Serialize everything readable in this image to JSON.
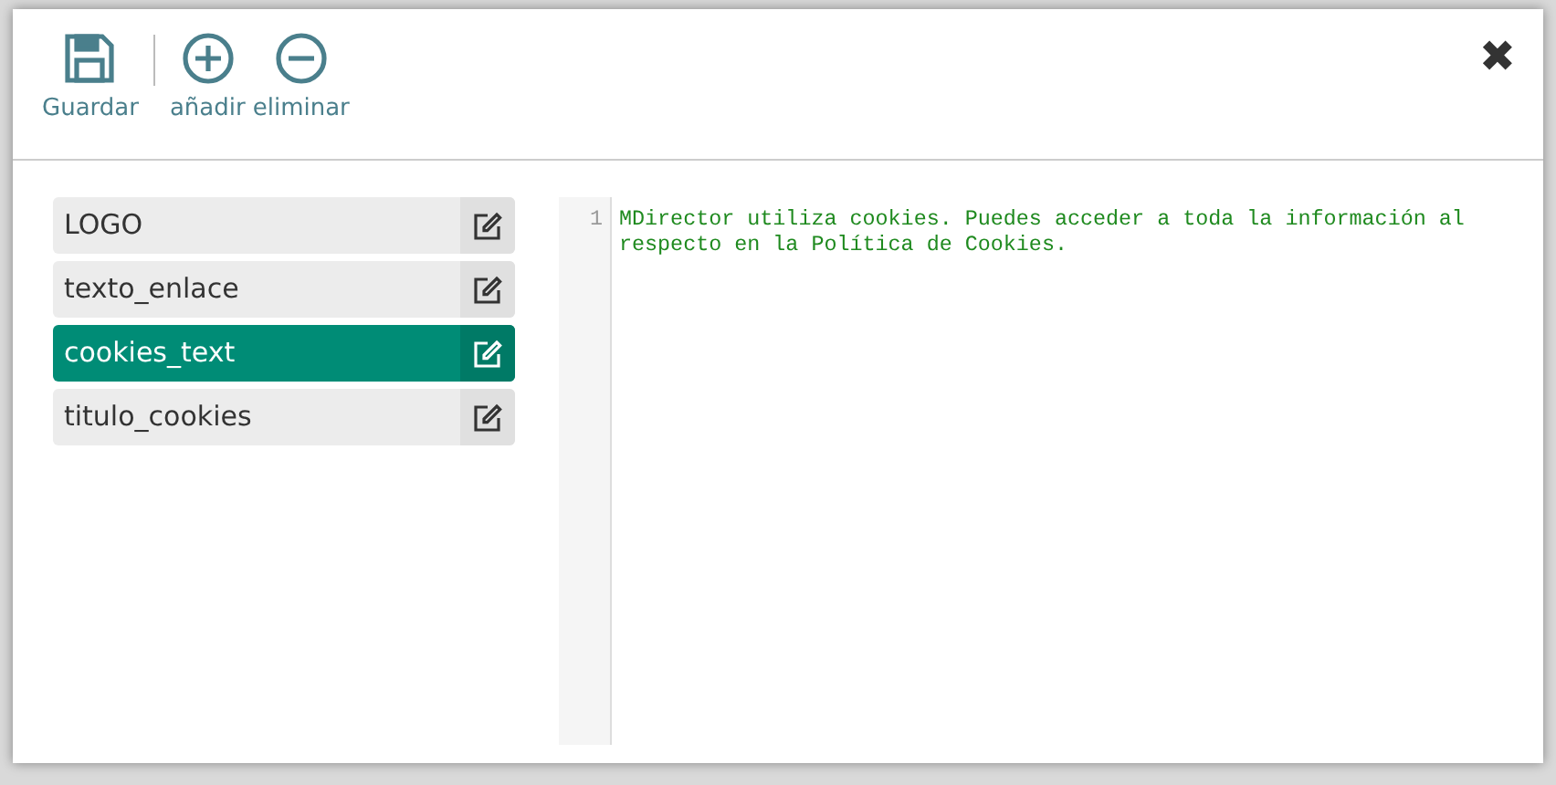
{
  "toolbar": [
    {
      "kind": "save",
      "label": "Guardar"
    },
    {
      "kind": "add",
      "label": "añadir"
    },
    {
      "kind": "remove",
      "label": "eliminar"
    }
  ],
  "close": {
    "symbol": "✖"
  },
  "items": [
    {
      "label": "LOGO",
      "selected": false
    },
    {
      "label": "texto_enlace",
      "selected": false
    },
    {
      "label": "cookies_text",
      "selected": true
    },
    {
      "label": "titulo_cookies",
      "selected": false
    }
  ],
  "editor": {
    "lines": [
      {
        "number": "1",
        "text": "MDirector utiliza cookies. Puedes acceder a toda la información al respecto en la Política de Cookies."
      }
    ]
  }
}
